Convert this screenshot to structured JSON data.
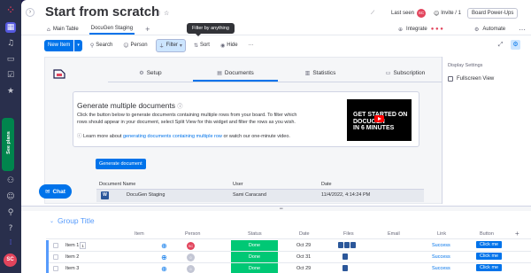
{
  "header": {
    "title": "Start from scratch",
    "last_seen_label": "Last seen",
    "last_seen_avatar": "SC",
    "invite_label": "Invite / 1",
    "power_ups_label": "Board Power-Ups"
  },
  "tabs": [
    {
      "label": "Main Table"
    },
    {
      "label": "DocuGen Staging"
    }
  ],
  "tab_actions": {
    "integrate_label": "Integrate",
    "automate_label": "Automate"
  },
  "toolbar": {
    "new_item_label": "New Item",
    "search_label": "Search",
    "person_label": "Person",
    "filter_label": "Filter",
    "sort_label": "Sort",
    "hide_label": "Hide",
    "more_label": "···",
    "tooltip": "Filter by anything"
  },
  "widget": {
    "tabs": [
      {
        "label": "Setup",
        "icon": "gear-icon"
      },
      {
        "label": "Documents",
        "icon": "document-icon"
      },
      {
        "label": "Statistics",
        "icon": "chart-icon"
      },
      {
        "label": "Subscription",
        "icon": "card-icon"
      }
    ],
    "card_title": "Generate multiple documents",
    "card_desc": "Click the button below to generate documents containing multiple rows from your board. To filter which rows should appear in your document, select Split View for this widget and filter the rows as you wish.",
    "learn_prefix": "Learn more about",
    "learn_link": "generating documents containing multiple row",
    "learn_suffix": "or watch our one-minute video.",
    "video_text_1": "GET STARTED ON",
    "video_text_2": "DOCUGEN",
    "video_text_3": "IN 6 MINUTES",
    "generate_button": "Generate document",
    "columns": [
      "Document Name",
      "User",
      "Date"
    ],
    "rows": [
      {
        "name": "DocuGen Staging",
        "user": "Sami Caracand",
        "date": "11/4/2022, 4:14:24 PM"
      }
    ]
  },
  "side_panel": {
    "heading": "Display Settings",
    "option": "Fullscreen View"
  },
  "rail": {
    "see_plans": "See plans",
    "avatar": "SC"
  },
  "chat_label": "Chat",
  "group": {
    "title": "Group Title",
    "columns": [
      "Item",
      "Person",
      "Status",
      "Date",
      "Files",
      "Email",
      "Link",
      "Button"
    ],
    "rows": [
      {
        "name": "Item 1",
        "badge": "1",
        "person": "SC",
        "status": "Done",
        "date": "Oct 29",
        "link": "Success",
        "button": "Click me"
      },
      {
        "name": "Item 2",
        "badge": "",
        "person": "",
        "status": "Done",
        "date": "Oct 31",
        "link": "Success",
        "button": "Click me"
      },
      {
        "name": "Item 3",
        "badge": "",
        "person": "",
        "status": "Done",
        "date": "Oct 29",
        "link": "Success",
        "button": "Click me"
      }
    ]
  },
  "colors": {
    "accent": "#0073ea",
    "done": "#00c875",
    "group": "#579bfc",
    "rail": "#292f4c"
  }
}
